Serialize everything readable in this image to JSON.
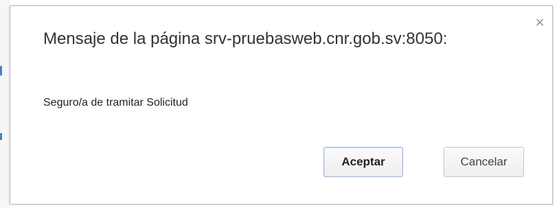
{
  "dialog": {
    "title": "Mensaje de la página srv-pruebasweb.cnr.gob.sv:8050:",
    "close_symbol": "×",
    "message": "Seguro/a de tramitar Solicitud",
    "buttons": {
      "accept_label": "Aceptar",
      "cancel_label": "Cancelar"
    }
  },
  "icons": {
    "close": "close-icon"
  },
  "colors": {
    "dialog_background": "#ffffff",
    "dialog_border": "#b9b9b9",
    "primary_button_border": "#9cb4df",
    "text": "#333333",
    "background_edge": "#f4f6f8",
    "background_mark": "#4a7fc0"
  }
}
